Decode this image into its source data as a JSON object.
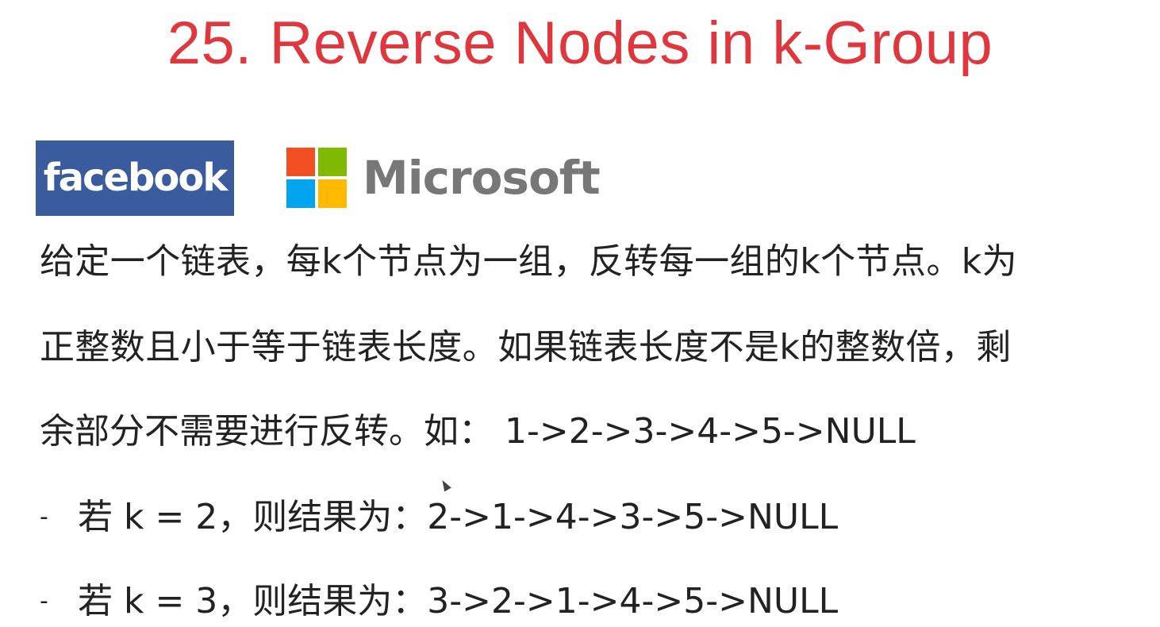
{
  "title": "25. Reverse Nodes in k-Group",
  "logos": {
    "facebook_text": "facebook",
    "facebook_color": "#3b5b9f",
    "microsoft_text": "Microsoft",
    "microsoft_colors": [
      "#f25022",
      "#7fba00",
      "#00a4ef",
      "#ffb900"
    ]
  },
  "description": {
    "line1": "给定一个链表，每k个节点为一组，反转每一组的k个节点。k为",
    "line2": "正整数且小于等于链表长度。如果链表长度不是k的整数倍，剩",
    "line3": "余部分不需要进行反转。如： 1->2->3->4->5->NULL"
  },
  "examples": [
    {
      "bullet": "-",
      "text": "若 k = 2，则结果为：2->1->4->3->5->NULL"
    },
    {
      "bullet": "-",
      "text": "若 k = 3，则结果为：3->2->1->4->5->NULL"
    }
  ],
  "colors": {
    "title": "#e0363e",
    "body_text": "#222222"
  }
}
